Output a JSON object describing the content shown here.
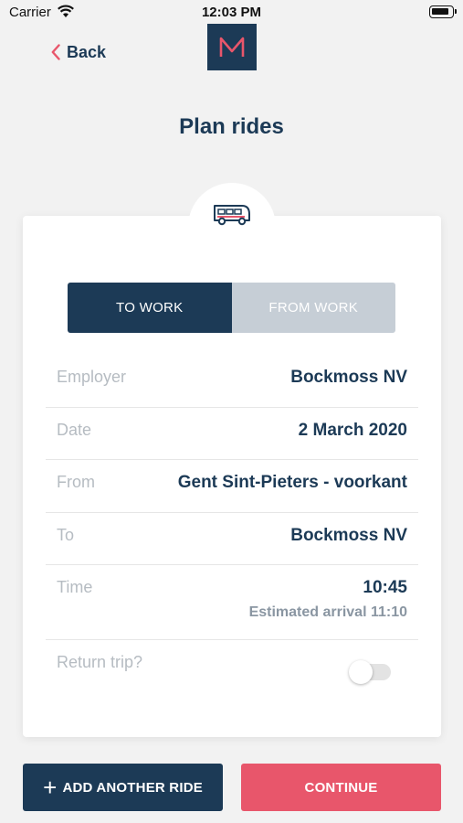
{
  "status_bar": {
    "carrier": "Carrier",
    "time": "12:03 PM"
  },
  "header": {
    "back_label": "Back",
    "title": "Plan rides",
    "logo_letter": "M"
  },
  "direction_tabs": [
    {
      "label": "TO WORK",
      "selected": true
    },
    {
      "label": "FROM WORK",
      "selected": false
    }
  ],
  "form": {
    "employer": {
      "label": "Employer",
      "value": "Bockmoss NV"
    },
    "date": {
      "label": "Date",
      "value": "2 March 2020"
    },
    "from": {
      "label": "From",
      "value": "Gent Sint-Pieters - voorkant"
    },
    "to": {
      "label": "To",
      "value": "Bockmoss NV"
    },
    "time": {
      "label": "Time",
      "value": "10:45",
      "estimate": "Estimated arrival 11:10"
    },
    "return_trip": {
      "label": "Return trip?",
      "enabled": false
    }
  },
  "actions": {
    "add_label": "ADD ANOTHER RIDE",
    "continue_label": "CONTINUE"
  },
  "colors": {
    "primary": "#1c3a56",
    "accent": "#e8566b",
    "inactive_tab": "#c6ced6"
  }
}
